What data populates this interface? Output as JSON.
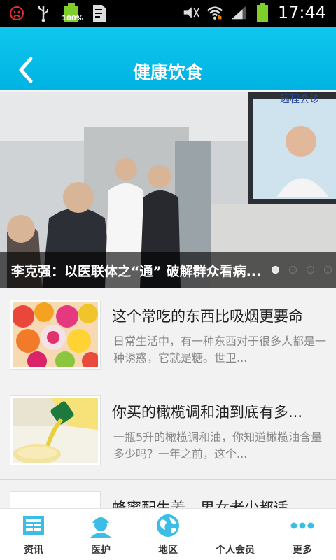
{
  "status_bar": {
    "time": "17:44",
    "battery_percent": "100%"
  },
  "header": {
    "title": "健康饮食"
  },
  "banner": {
    "caption": "李克强：以医联体之“通” 破解群众看病...",
    "slide_count": 4,
    "active_slide": 1,
    "wall_sign": "远程会诊"
  },
  "articles": [
    {
      "title": "这个常吃的东西比吸烟更要命",
      "summary": "日常生活中，有一种东西对于很多人都是一种诱惑，它就是糖。世卫..."
    },
    {
      "title": "你买的橄榄调和油到底有多...",
      "summary": "一瓶5升的橄榄调和油，你知道橄榄油含量多少吗？一年之前，这个..."
    },
    {
      "title": "蜂蜜配生姜，男女老少都适",
      "summary": ""
    }
  ],
  "tabs": [
    {
      "label": "资讯",
      "icon": "newspaper-icon"
    },
    {
      "label": "医护",
      "icon": "nurse-icon"
    },
    {
      "label": "地区",
      "icon": "globe-icon"
    },
    {
      "label": "个人会员",
      "icon": "member-icon"
    },
    {
      "label": "更多",
      "icon": "more-dots-icon"
    }
  ],
  "colors": {
    "header": "#00b3e3",
    "tab_icon": "#3bbde8"
  }
}
